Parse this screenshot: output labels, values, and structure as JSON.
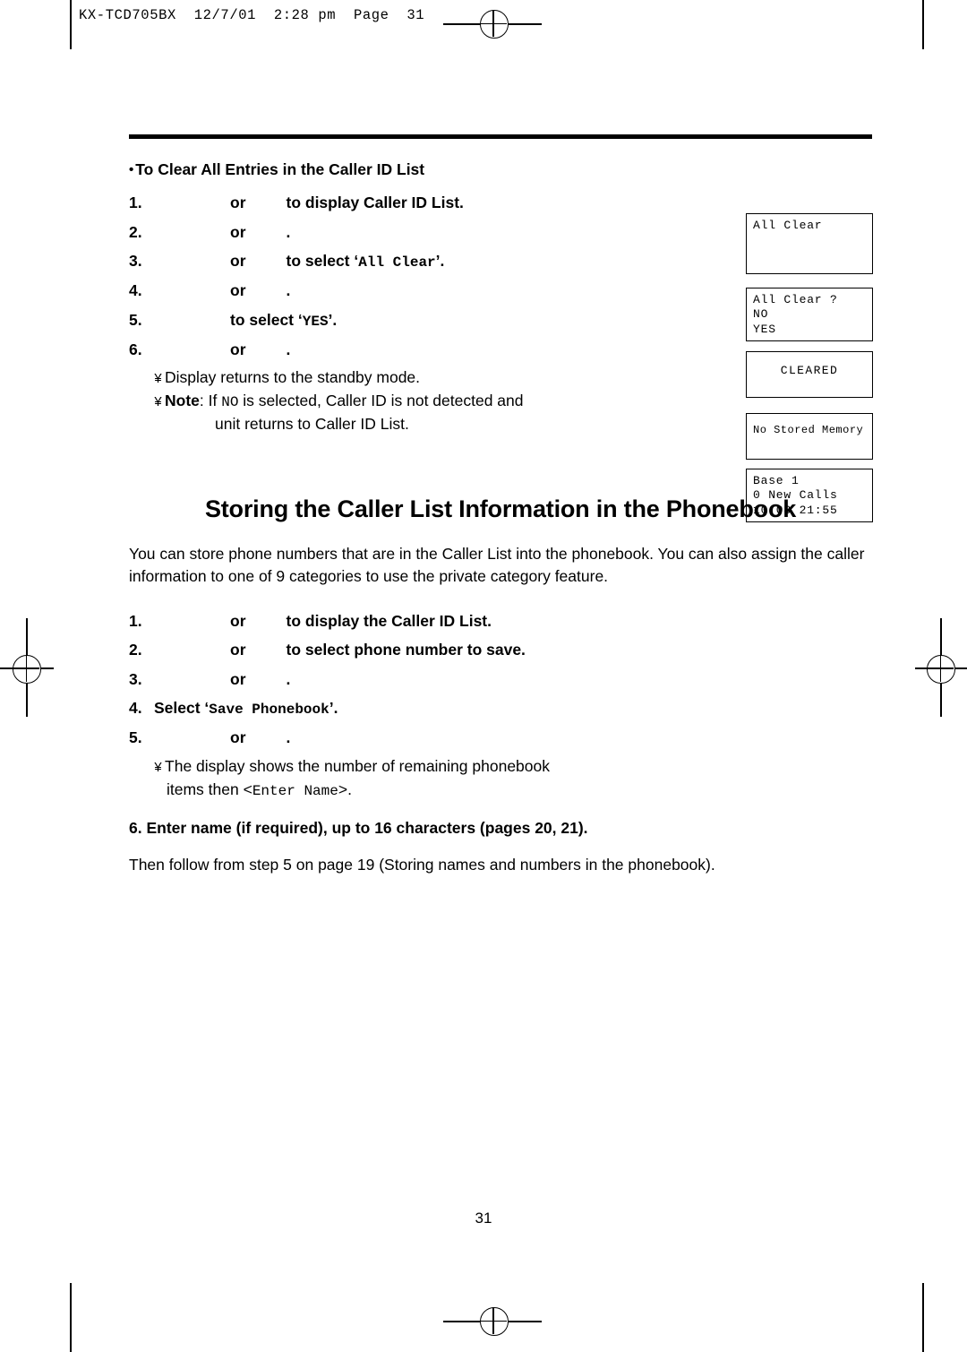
{
  "header": {
    "text": "KX-TCD705BX  12/7/01  2:28 pm  Page  31"
  },
  "section1": {
    "bullet_title": "To Clear All Entries in the Caller ID List",
    "steps": [
      {
        "num": "1.",
        "or": "or",
        "text": "to display Caller ID List."
      },
      {
        "num": "2.",
        "or": "or",
        "text": "."
      },
      {
        "num": "3.",
        "or": "or",
        "text": "to select ‘",
        "mono": "All Clear",
        "text2": "’."
      },
      {
        "num": "4.",
        "or": "or",
        "text": "."
      },
      {
        "num": "5.",
        "or": "",
        "text": "to select ‘",
        "mono": "YES",
        "text2": "’."
      },
      {
        "num": "6.",
        "or": "or",
        "text": "."
      }
    ],
    "note1": "Display returns to the standby mode.",
    "note2_label": "Note",
    "note2_a": ": If ",
    "note2_mono": "NO",
    "note2_b": " is selected, Caller ID is not detected and",
    "note2_c": "unit returns to Caller ID List."
  },
  "lcds": [
    {
      "name": "lcd-all-clear",
      "lines": "All Clear"
    },
    {
      "name": "lcd-all-clear-confirm",
      "lines": "All Clear ?\nNO\nYES"
    },
    {
      "name": "lcd-cleared",
      "lines": "CLEARED"
    },
    {
      "name": "lcd-no-stored-memory",
      "lines": "No Stored Memory"
    },
    {
      "name": "lcd-base-standby",
      "lines": "Base 1\n0 New Calls\n10.08 21:55"
    }
  ],
  "section2": {
    "title": "Storing the Caller List Information in the Phonebook",
    "intro": "You can store phone numbers that are in the Caller List into the phonebook. You can also assign the caller information to one of 9 categories to use the private category feature.",
    "steps": [
      {
        "num": "1.",
        "or": "or",
        "text": "to display the Caller ID List."
      },
      {
        "num": "2.",
        "or": "or",
        "text": "to select phone number to save."
      },
      {
        "num": "3.",
        "or": "or",
        "text": "."
      },
      {
        "num": "4.",
        "or": "",
        "text": "Select ‘",
        "mono": "Save Phonebook",
        "text2": "’."
      },
      {
        "num": "5.",
        "or": "or",
        "text": "."
      }
    ],
    "note1_a": "The display shows the number of remaining phonebook",
    "note1_b": "items then <",
    "note1_mono": "Enter Name",
    "note1_c": ">.",
    "step6": "6.   Enter name (if required), up to 16 characters (pages 20, 21).",
    "closing": "Then follow from step 5 on page 19 (Storing names and numbers in the phonebook)."
  },
  "page_number": "31"
}
